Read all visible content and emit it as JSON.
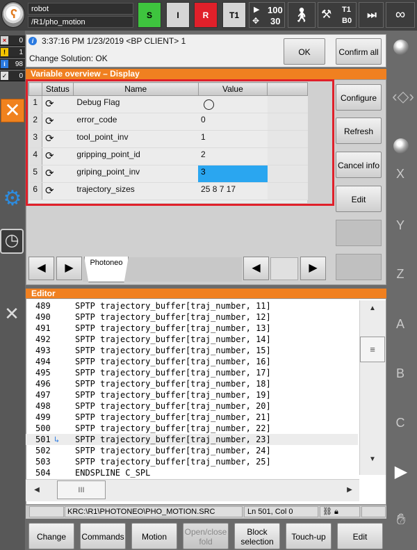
{
  "robot": {
    "name": "robot",
    "path": "/R1/pho_motion"
  },
  "status": {
    "s": "S",
    "i": "I",
    "r": "R",
    "mode": "T1",
    "prog_override": "100",
    "jog_override": "30",
    "tool": "T1",
    "base": "B0",
    "increment": "⏭",
    "infinite": "∞"
  },
  "counters": [
    {
      "icon": "×",
      "count": "0"
    },
    {
      "icon": "!",
      "count": "1"
    },
    {
      "icon": "i",
      "count": "98"
    },
    {
      "icon": "✓",
      "count": "0"
    }
  ],
  "message": {
    "timestamp": "3:37:16 PM 1/23/2019 <BP CLIENT> 1",
    "detail": "Change Solution: OK",
    "ok_label": "OK",
    "confirm_all_label": "Confirm all"
  },
  "var_overview": {
    "title": "Variable overview – Display",
    "columns": {
      "status": "Status",
      "name": "Name",
      "value": "Value"
    },
    "rows": [
      {
        "num": "1",
        "name": "Debug Flag",
        "value": ""
      },
      {
        "num": "2",
        "name": "error_code",
        "value": "0"
      },
      {
        "num": "3",
        "name": "tool_point_inv",
        "value": "1"
      },
      {
        "num": "4",
        "name": "gripping_point_id",
        "value": "2"
      },
      {
        "num": "5",
        "name": "griping_point_inv",
        "value": "3"
      },
      {
        "num": "6",
        "name": "trajectory_sizes",
        "value": "25 8 7 17"
      }
    ],
    "tab": "Photoneo",
    "buttons": {
      "configure": "Configure",
      "refresh": "Refresh",
      "cancel_info": "Cancel info",
      "edit": "Edit"
    }
  },
  "editor": {
    "title": "Editor",
    "lines": [
      {
        "num": "489",
        "code": "SPTP trajectory_buffer[traj_number, 11]"
      },
      {
        "num": "490",
        "code": "SPTP trajectory_buffer[traj_number, 12]"
      },
      {
        "num": "491",
        "code": "SPTP trajectory_buffer[traj_number, 13]"
      },
      {
        "num": "492",
        "code": "SPTP trajectory_buffer[traj_number, 14]"
      },
      {
        "num": "493",
        "code": "SPTP trajectory_buffer[traj_number, 15]"
      },
      {
        "num": "494",
        "code": "SPTP trajectory_buffer[traj_number, 16]"
      },
      {
        "num": "495",
        "code": "SPTP trajectory_buffer[traj_number, 17]"
      },
      {
        "num": "496",
        "code": "SPTP trajectory_buffer[traj_number, 18]"
      },
      {
        "num": "497",
        "code": "SPTP trajectory_buffer[traj_number, 19]"
      },
      {
        "num": "498",
        "code": "SPTP trajectory_buffer[traj_number, 20]"
      },
      {
        "num": "499",
        "code": "SPTP trajectory_buffer[traj_number, 21]"
      },
      {
        "num": "500",
        "code": "SPTP trajectory_buffer[traj_number, 22]"
      },
      {
        "num": "501",
        "code": "SPTP trajectory_buffer[traj_number, 23]"
      },
      {
        "num": "502",
        "code": "SPTP trajectory_buffer[traj_number, 24]"
      },
      {
        "num": "503",
        "code": "SPTP trajectory_buffer[traj_number, 25]"
      },
      {
        "num": "504",
        "code": "ENDSPLINE C_SPL"
      }
    ],
    "current_line": "501",
    "file_path": "KRC:\\R1\\PHOTONEO\\PHO_MOTION.SRC",
    "cursor_pos": "Ln 501, Col 0"
  },
  "softkeys": {
    "change": "Change",
    "commands": "Commands",
    "motion": "Motion",
    "fold_line1": "Open/close",
    "fold_line2": "fold",
    "block_line1": "Block",
    "block_line2": "selection",
    "touch_up": "Touch-up",
    "edit": "Edit"
  },
  "axes": {
    "x": "X",
    "y": "Y",
    "z": "Z",
    "a": "A",
    "b": "B",
    "c": "C"
  }
}
